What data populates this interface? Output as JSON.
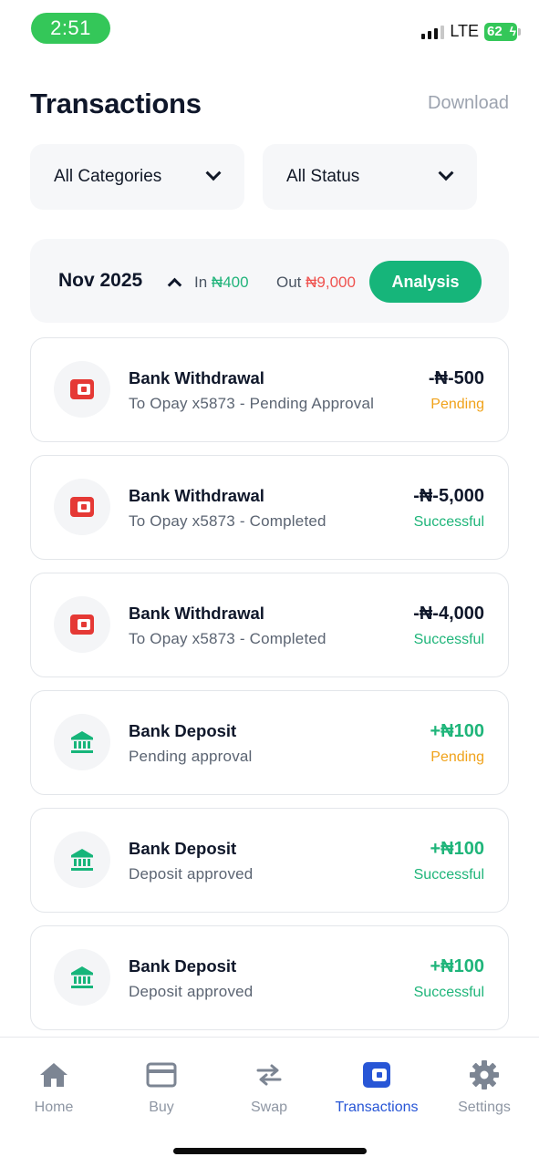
{
  "status_bar": {
    "time": "2:51",
    "network": "LTE",
    "battery": "62"
  },
  "header": {
    "title": "Transactions",
    "download_label": "Download"
  },
  "filters": {
    "category": "All Categories",
    "status": "All Status"
  },
  "summary": {
    "month": "Nov 2025",
    "in_label": "In",
    "in_value": "₦400",
    "out_label": "Out",
    "out_value": "₦9,000",
    "analysis_label": "Analysis"
  },
  "transactions": [
    {
      "title": "Bank Withdrawal",
      "subtitle": "To Opay x5873 - Pending Approval",
      "amount": "-₦-500",
      "status": "Pending",
      "kind": "withdrawal",
      "status_type": "pending"
    },
    {
      "title": "Bank Withdrawal",
      "subtitle": "To Opay x5873 - Completed",
      "amount": "-₦-5,000",
      "status": "Successful",
      "kind": "withdrawal",
      "status_type": "success"
    },
    {
      "title": "Bank Withdrawal",
      "subtitle": "To Opay x5873 - Completed",
      "amount": "-₦-4,000",
      "status": "Successful",
      "kind": "withdrawal",
      "status_type": "success"
    },
    {
      "title": "Bank Deposit",
      "subtitle": "Pending approval",
      "amount": "+₦100",
      "status": "Pending",
      "kind": "deposit",
      "status_type": "pending"
    },
    {
      "title": "Bank Deposit",
      "subtitle": "Deposit approved",
      "amount": "+₦100",
      "status": "Successful",
      "kind": "deposit",
      "status_type": "success"
    },
    {
      "title": "Bank Deposit",
      "subtitle": "Deposit approved",
      "amount": "+₦100",
      "status": "Successful",
      "kind": "deposit",
      "status_type": "success"
    }
  ],
  "nav": {
    "items": [
      {
        "label": "Home",
        "icon": "home-icon"
      },
      {
        "label": "Buy",
        "icon": "card-icon"
      },
      {
        "label": "Swap",
        "icon": "swap-icon"
      },
      {
        "label": "Transactions",
        "icon": "wallet-icon",
        "active": true
      },
      {
        "label": "Settings",
        "icon": "gear-icon"
      }
    ]
  },
  "colors": {
    "accent_green": "#16b57a",
    "danger_red": "#e53935",
    "pending_orange": "#f0a21a",
    "active_blue": "#2856d6"
  }
}
